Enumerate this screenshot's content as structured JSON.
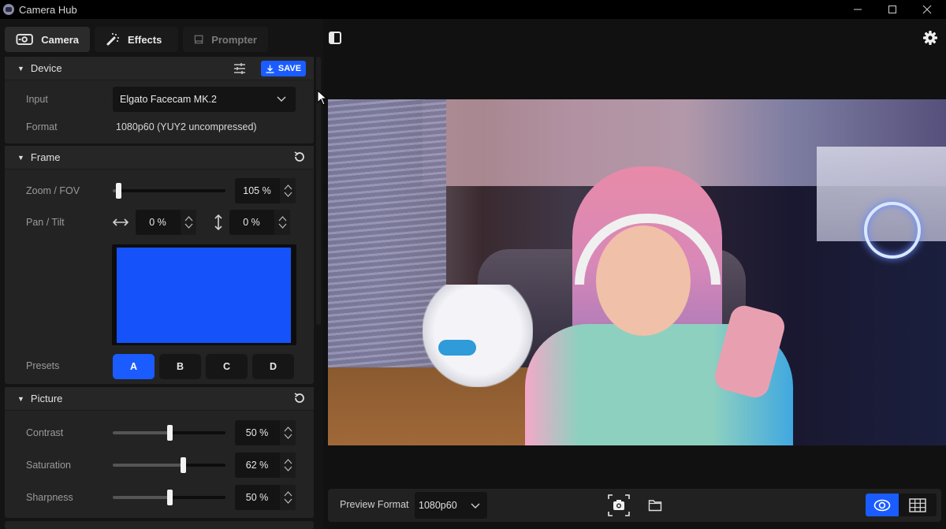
{
  "window": {
    "title": "Camera Hub",
    "controls": {
      "minimize": "minimize-icon",
      "maximize": "maximize-icon",
      "close": "close-icon"
    }
  },
  "tabs": [
    {
      "label": "Camera",
      "icon": "camera-icon",
      "active": true
    },
    {
      "label": "Effects",
      "icon": "magic-wand-icon",
      "active": false
    },
    {
      "label": "Prompter",
      "icon": "prompter-icon",
      "active": false
    }
  ],
  "device": {
    "title": "Device",
    "save_label": "SAVE",
    "input_label": "Input",
    "input_value": "Elgato Facecam MK.2",
    "format_label": "Format",
    "format_value": "1080p60 (YUY2 uncompressed)"
  },
  "frame": {
    "title": "Frame",
    "zoom_label": "Zoom / FOV",
    "zoom_value": "105 %",
    "zoom_slider_fraction": 0.05,
    "pan_tilt_label": "Pan / Tilt",
    "pan_value": "0 %",
    "tilt_value": "0 %",
    "presets_label": "Presets",
    "presets": [
      "A",
      "B",
      "C",
      "D"
    ],
    "active_preset": "A",
    "frame_color": "#1652fa"
  },
  "picture": {
    "title": "Picture",
    "controls": [
      {
        "label": "Contrast",
        "value": "50 %",
        "fraction": 0.5
      },
      {
        "label": "Saturation",
        "value": "62 %",
        "fraction": 0.62
      },
      {
        "label": "Sharpness",
        "value": "50 %",
        "fraction": 0.5
      }
    ]
  },
  "bottombar": {
    "preview_format_label": "Preview Format",
    "preview_format_value": "1080p60"
  },
  "colors": {
    "accent": "#1a5cff",
    "panel": "#232323",
    "background": "#111111"
  }
}
